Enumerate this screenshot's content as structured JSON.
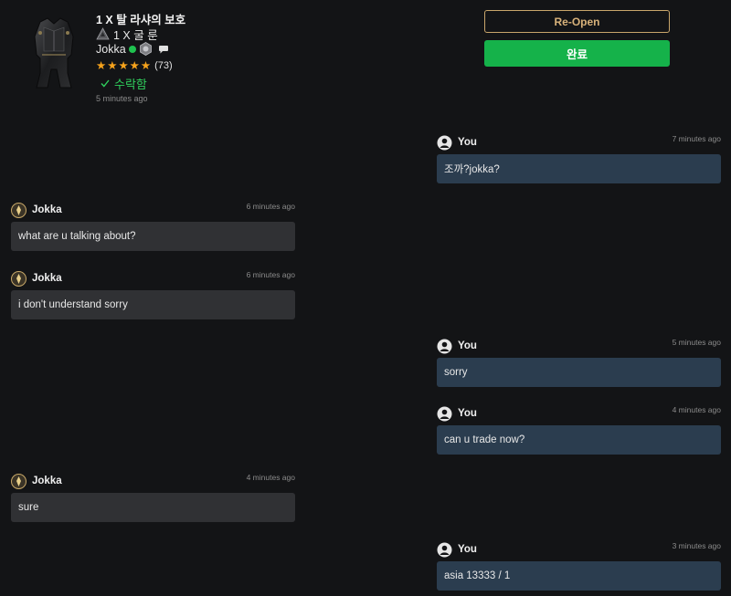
{
  "item": {
    "title": "1 X 탈 라샤의 보호",
    "quantity_label": "1 X 굴 룬",
    "seller_name": "Jokka",
    "rating_stars": 5,
    "rating_count": "(73)",
    "status_text": "수락함",
    "time": "5 minutes ago",
    "icons": [
      "armor-item-image",
      "rune-icon",
      "online-dot",
      "rank-badge-icon",
      "chat-bubble-icon",
      "star-icon",
      "check-icon"
    ]
  },
  "buttons": {
    "reopen": "Re-Open",
    "complete": "완료"
  },
  "colors": {
    "background": "#131416",
    "reopen_border": "#c9a66b",
    "complete_bg": "#15b24a",
    "star": "#f7a31c",
    "online": "#1fc24f",
    "accepted": "#2fcf5c",
    "bubble_them": "#303134",
    "bubble_me": "#2b3d4f"
  },
  "messages": [
    {
      "sender": "You",
      "time": "7 minutes ago",
      "text": "조까?jokka?",
      "mine": true
    },
    {
      "sender": "Jokka",
      "time": "6 minutes ago",
      "text": "what are u talking about?",
      "mine": false
    },
    {
      "sender": "Jokka",
      "time": "6 minutes ago",
      "text": "i don't understand sorry",
      "mine": false
    },
    {
      "sender": "You",
      "time": "5 minutes ago",
      "text": "sorry",
      "mine": true
    },
    {
      "sender": "You",
      "time": "4 minutes ago",
      "text": "can u trade now?",
      "mine": true
    },
    {
      "sender": "Jokka",
      "time": "4 minutes ago",
      "text": "sure",
      "mine": false
    },
    {
      "sender": "You",
      "time": "3 minutes ago",
      "text": "asia 13333 / 1",
      "mine": true
    }
  ]
}
